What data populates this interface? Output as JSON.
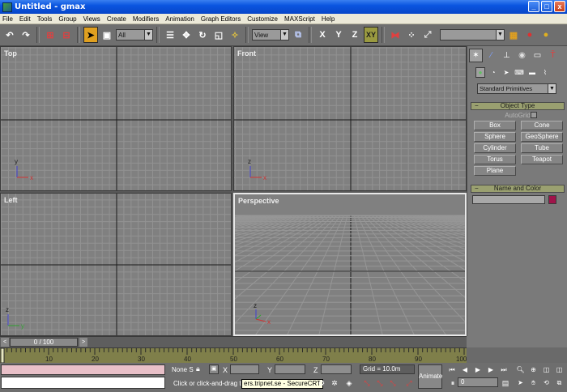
{
  "window": {
    "title": "Untitled - gmax",
    "minimize": "_",
    "maximize": "□",
    "close": "x"
  },
  "menu": [
    "File",
    "Edit",
    "Tools",
    "Group",
    "Views",
    "Create",
    "Modifiers",
    "Animation",
    "Graph Editors",
    "Customize",
    "MAXScript",
    "Help"
  ],
  "toolbar": {
    "filter_value": "All",
    "coord_value": "View",
    "axis_x": "X",
    "axis_y": "Y",
    "axis_z": "Z",
    "axis_xy": "XY"
  },
  "viewports": {
    "top": "Top",
    "front": "Front",
    "left": "Left",
    "perspective": "Perspective",
    "axis_labels": {
      "x": "x",
      "y": "y",
      "z": "z"
    }
  },
  "command_panel": {
    "category": "Standard Primitives",
    "object_type": {
      "title": "Object Type",
      "autogrid": "AutoGrid",
      "buttons": [
        "Box",
        "Cone",
        "Sphere",
        "GeoSphere",
        "Cylinder",
        "Tube",
        "Torus",
        "Teapot",
        "Plane"
      ]
    },
    "name_color": {
      "title": "Name and Color",
      "swatch_color": "#a0144a"
    }
  },
  "time_slider": {
    "label": "0 / 100",
    "position": 0,
    "max": 100
  },
  "track": {
    "ticks": [
      "10",
      "20",
      "30",
      "40",
      "50",
      "60",
      "70",
      "80",
      "90",
      "100"
    ]
  },
  "status": {
    "selection": "None S",
    "x_label": "X",
    "y_label": "Y",
    "z_label": "Z",
    "grid": "Grid = 10.0m",
    "prompt": "Click or click-and-drag to",
    "tooltip": "ers.tripnet.se - SecureCRT",
    "animate": "Animate",
    "frame": "0"
  }
}
